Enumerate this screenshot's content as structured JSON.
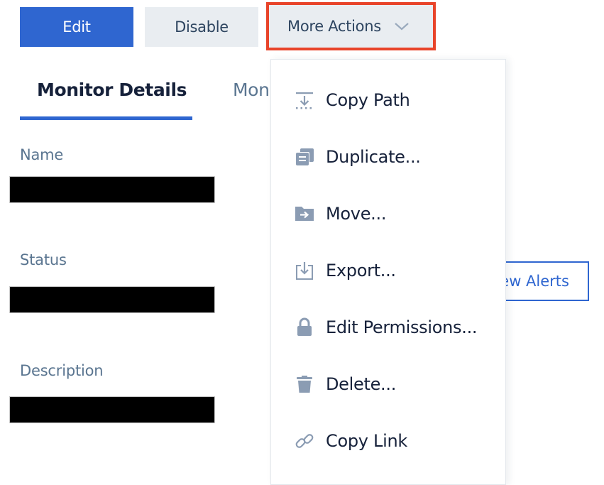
{
  "toolbar": {
    "edit_label": "Edit",
    "disable_label": "Disable",
    "more_actions_label": "More Actions"
  },
  "tabs": [
    {
      "label": "Monitor Details",
      "active": true
    },
    {
      "label": "Monitor",
      "active": false
    }
  ],
  "fields": [
    {
      "label": "Name",
      "value": "[redacted]"
    },
    {
      "label": "Status",
      "value": "[redacted]"
    },
    {
      "label": "Description",
      "value": "[redacted]"
    }
  ],
  "view_alerts_label": "View Alerts",
  "menu": {
    "items": [
      {
        "label": "Copy Path",
        "icon": "copy-path-icon"
      },
      {
        "label": "Duplicate...",
        "icon": "duplicate-icon"
      },
      {
        "label": "Move...",
        "icon": "move-folder-icon"
      },
      {
        "label": "Export...",
        "icon": "export-icon"
      },
      {
        "label": "Edit Permissions...",
        "icon": "lock-icon"
      },
      {
        "label": "Delete...",
        "icon": "trash-icon"
      },
      {
        "label": "Copy Link",
        "icon": "link-icon"
      }
    ]
  },
  "colors": {
    "primary": "#2f66d0",
    "highlight_border": "#e8442a",
    "icon_gray": "#8b9cb3",
    "text_dark": "#16213a",
    "text_muted": "#5a7590"
  }
}
